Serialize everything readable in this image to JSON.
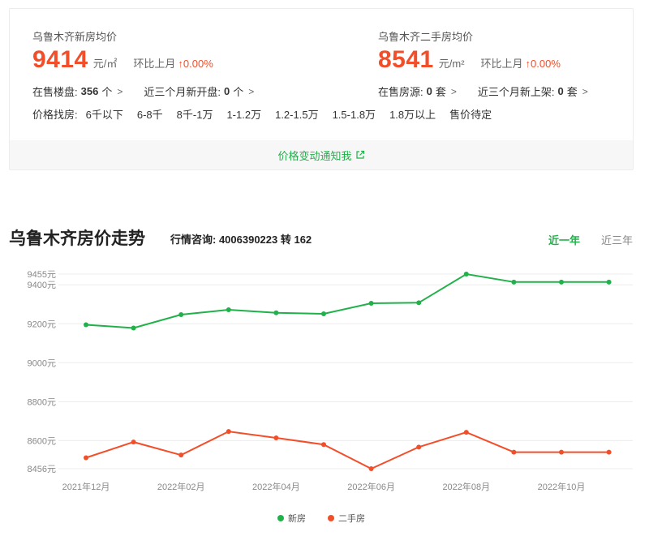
{
  "summary": {
    "new": {
      "title": "乌鲁木齐新房均价",
      "price": "9414",
      "unit": "元/㎡",
      "mom_label": "环比上月",
      "mom_value": "↑0.00%",
      "stat1_label": "在售楼盘:",
      "stat1_value": "356",
      "stat1_unit": "个",
      "stat2_label": "近三个月新开盘:",
      "stat2_value": "0",
      "stat2_unit": "个"
    },
    "second": {
      "title": "乌鲁木齐二手房均价",
      "price": "8541",
      "unit": "元/m²",
      "mom_label": "环比上月",
      "mom_value": "↑0.00%",
      "stat1_label": "在售房源:",
      "stat1_value": "0",
      "stat1_unit": "套",
      "stat2_label": "近三个月新上架:",
      "stat2_value": "0",
      "stat2_unit": "套"
    },
    "filters": {
      "label": "价格找房:",
      "items": [
        "6千以下",
        "6-8千",
        "8千-1万",
        "1-1.2万",
        "1.2-1.5万",
        "1.5-1.8万",
        "1.8万以上",
        "售价待定"
      ]
    },
    "notify_label": "价格变动通知我"
  },
  "trend": {
    "title": "乌鲁木齐房价走势",
    "consult": "行情咨询: 4006390223 转 162",
    "tabs": [
      "近一年",
      "近三年"
    ],
    "active_tab": 0
  },
  "colors": {
    "new": "#21b14a",
    "second": "#f24e2a",
    "accent": "#21b14a"
  },
  "icons": {
    "chevron": "chevron-right-icon",
    "external": "external-link-icon"
  },
  "chart_data": {
    "type": "line",
    "x": [
      "2021年12月",
      "2022年01月",
      "2022年02月",
      "2022年03月",
      "2022年04月",
      "2022年05月",
      "2022年06月",
      "2022年07月",
      "2022年08月",
      "2022年09月",
      "2022年10月",
      "2022年11月"
    ],
    "x_tick_labels": [
      "2021年12月",
      "",
      "2022年02月",
      "",
      "2022年04月",
      "",
      "2022年06月",
      "",
      "2022年08月",
      "",
      "2022年10月",
      ""
    ],
    "y_ticks": [
      "8456元",
      "8600元",
      "8800元",
      "9000元",
      "9200元",
      "9400元",
      "9455元"
    ],
    "y_tick_values": [
      8456,
      8600,
      8800,
      9000,
      9200,
      9400,
      9455
    ],
    "ylim": [
      8456,
      9455
    ],
    "grid": true,
    "legend_position": "bottom",
    "series": [
      {
        "name": "新房",
        "values": [
          9195,
          9178,
          9247,
          9272,
          9256,
          9251,
          9305,
          9308,
          9455,
          9414,
          9414,
          9414
        ]
      },
      {
        "name": "二手房",
        "values": [
          8512,
          8593,
          8526,
          8647,
          8614,
          8580,
          8456,
          8567,
          8643,
          8541,
          8541,
          8541
        ]
      }
    ]
  }
}
